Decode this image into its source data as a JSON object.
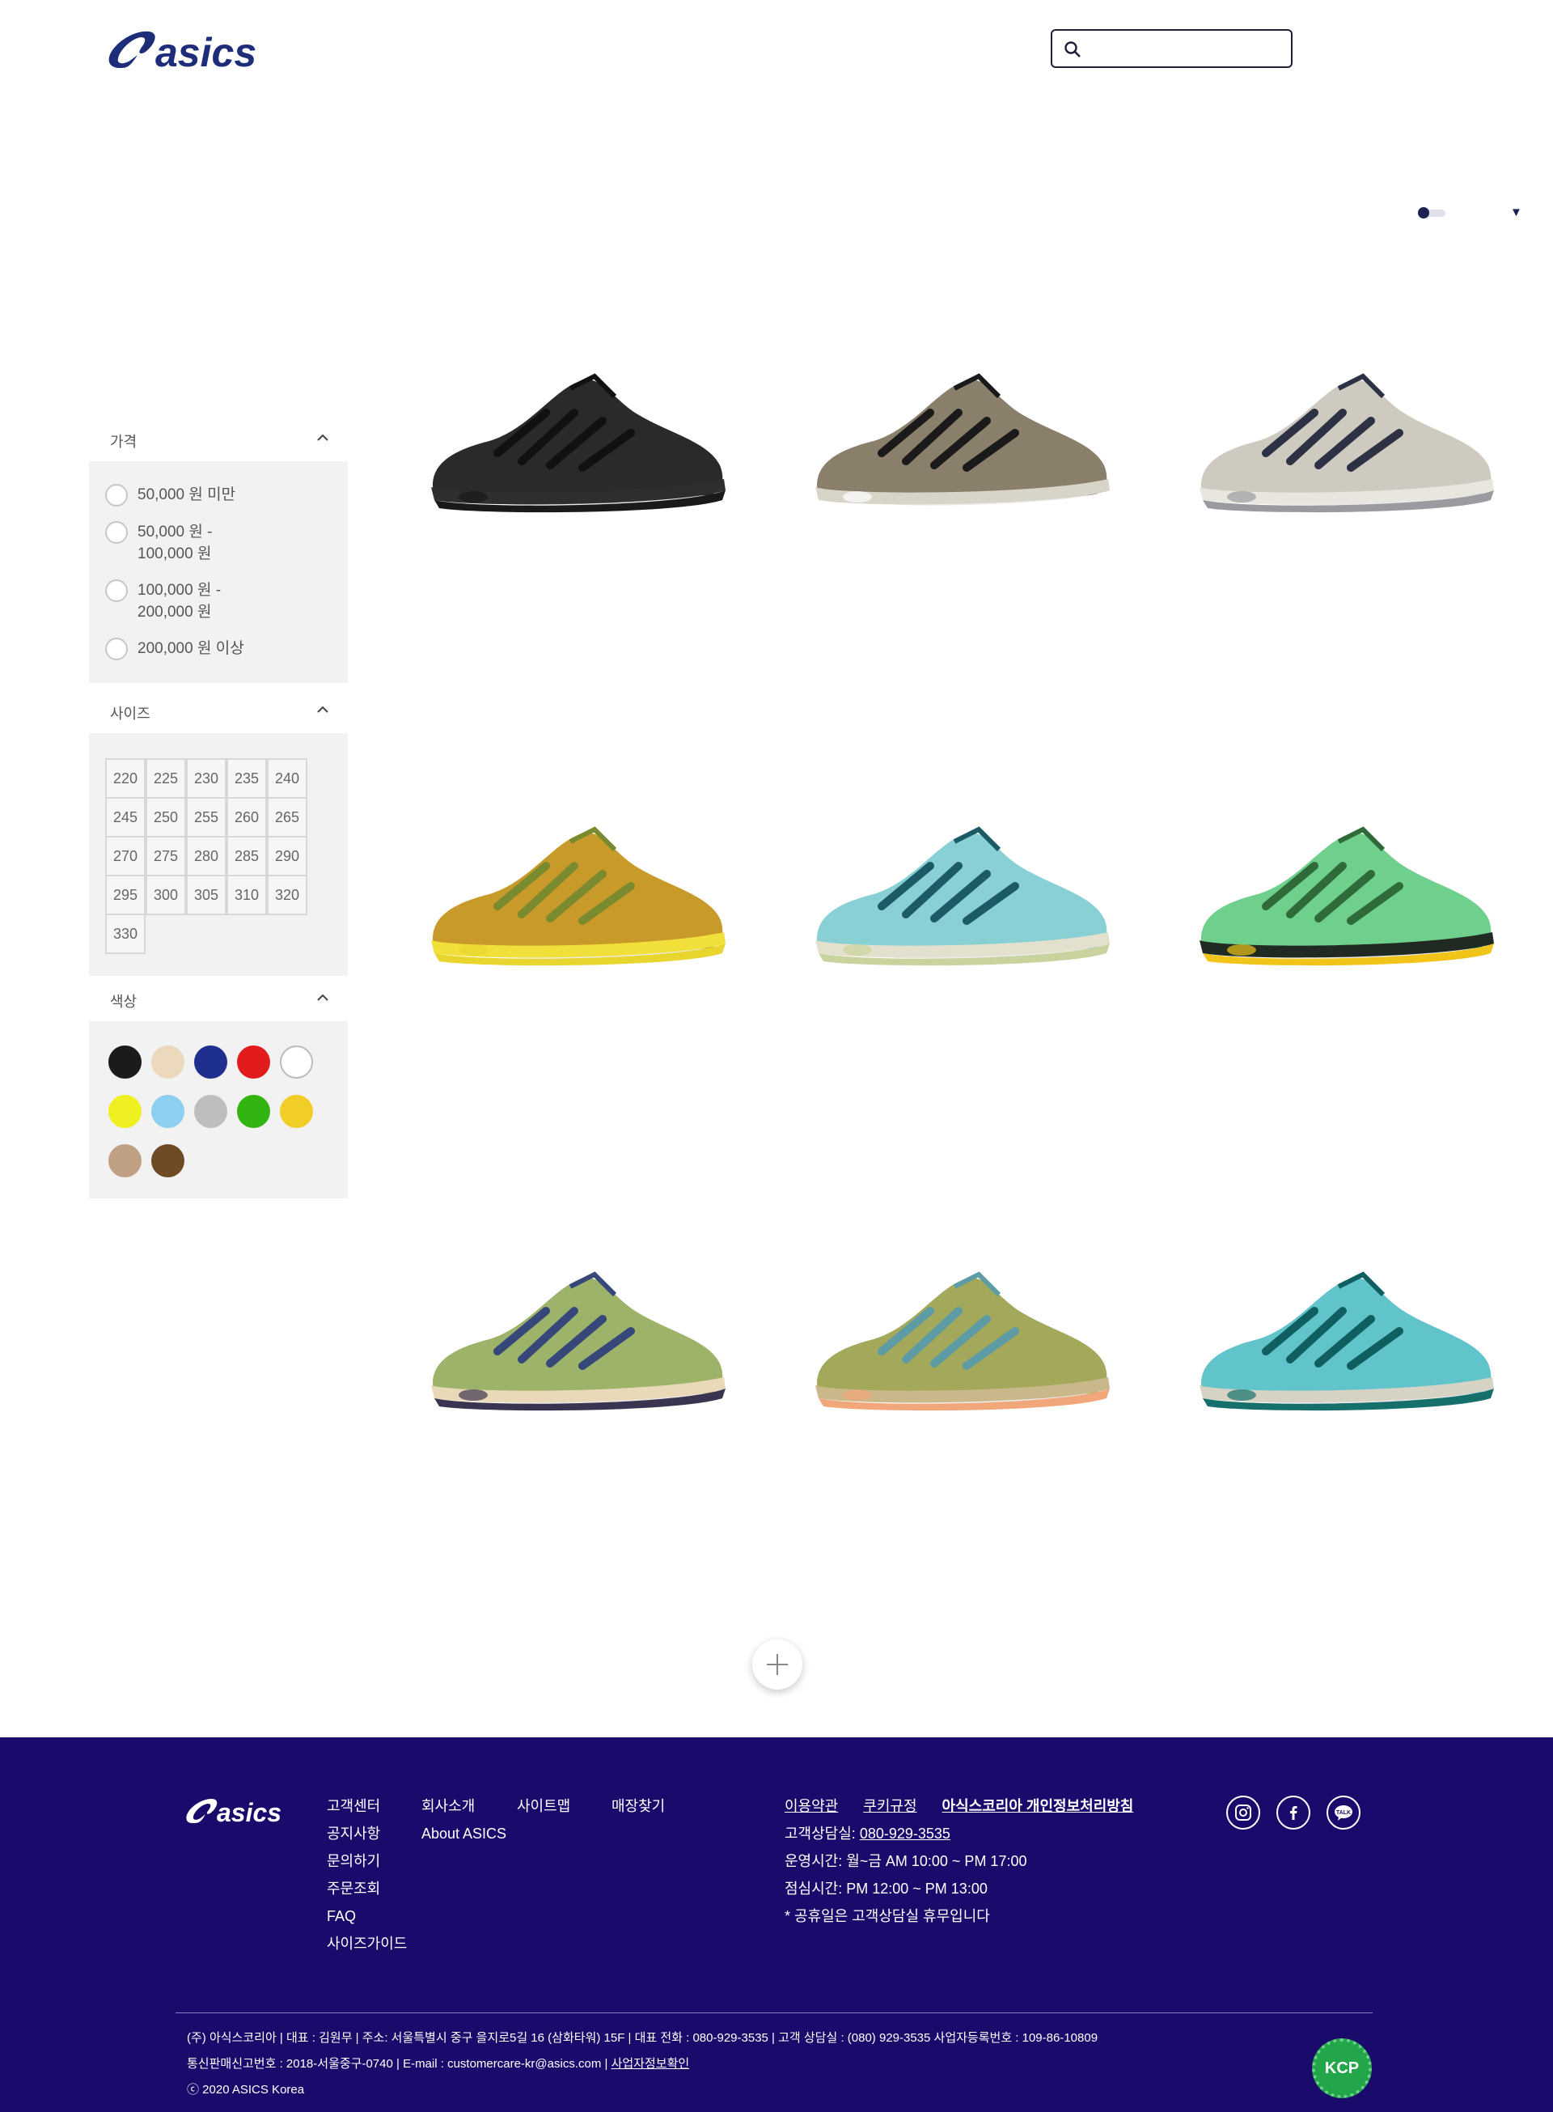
{
  "brand": {
    "name": "asics",
    "logo_text": "asics"
  },
  "search": {
    "placeholder": "",
    "value": ""
  },
  "filters": {
    "price": {
      "title": "가격",
      "options": [
        "50,000 원 미만",
        "50,000 원 - 100,000 원",
        "100,000 원 - 200,000 원",
        "200,000 원 이상"
      ]
    },
    "size": {
      "title": "사이즈",
      "options": [
        "220",
        "225",
        "230",
        "235",
        "240",
        "245",
        "250",
        "255",
        "260",
        "265",
        "270",
        "275",
        "280",
        "285",
        "290",
        "295",
        "300",
        "305",
        "310",
        "320",
        "330"
      ]
    },
    "color": {
      "title": "색상",
      "swatches": [
        "#1b1b1b",
        "#ecd9bd",
        "#1f2f8f",
        "#e21c1c",
        "#ffffff",
        "#eef022",
        "#8ccfee",
        "#bebebe",
        "#33b511",
        "#f1cd28",
        "#c0a083",
        "#6e4a25"
      ]
    }
  },
  "products": [
    {
      "name": "black-sneaker",
      "upper": "#2a2a2a",
      "accent": "#111111",
      "sole": "#1a1a1a",
      "midsole": "#2e2e2e"
    },
    {
      "name": "taupe-sneaker",
      "upper": "#8a7f6a",
      "accent": "#1a1a1a",
      "sole": "#ffffff",
      "midsole": "#d9d4c8"
    },
    {
      "name": "silver-sneaker",
      "upper": "#cfcac0",
      "accent": "#2c3143",
      "sole": "#9a9aa0",
      "midsole": "#e9e6df"
    },
    {
      "name": "yellow-brown-sneaker",
      "upper": "#c79a2a",
      "accent": "#7a8a2f",
      "sole": "#e8d52e",
      "midsole": "#f1e03a"
    },
    {
      "name": "teal-sneaker",
      "upper": "#89d0d5",
      "accent": "#1c5b66",
      "sole": "#c9d39d",
      "midsole": "#e3e0cd"
    },
    {
      "name": "green-sneaker",
      "upper": "#6fcf8c",
      "accent": "#2f6b3a",
      "sole": "#f0c419",
      "midsole": "#202a22"
    },
    {
      "name": "olive-blue-sneaker",
      "upper": "#9db36a",
      "accent": "#36477a",
      "sole": "#3b3450",
      "midsole": "#ead9b8"
    },
    {
      "name": "olive-orange-sneaker",
      "upper": "#a3a85a",
      "accent": "#5d9ca4",
      "sole": "#f2a77a",
      "midsole": "#c9b88a"
    },
    {
      "name": "teal-green-sneaker",
      "upper": "#62c4cb",
      "accent": "#0f5f61",
      "sole": "#15706c",
      "midsole": "#d6d2c4"
    }
  ],
  "footer": {
    "logo_text": "asics",
    "col1": [
      "고객센터",
      "공지사항",
      "문의하기",
      "주문조회",
      "FAQ",
      "사이즈가이드"
    ],
    "col2": [
      "회사소개",
      "About ASICS"
    ],
    "col3": [
      "사이트맵"
    ],
    "col4": [
      "매장찾기"
    ],
    "legal_links": [
      "이용약관",
      "쿠키규정",
      "아식스코리아 개인정보처리방침"
    ],
    "phone_label": "고객상담실: ",
    "phone": "080-929-3535",
    "hours": "운영시간: 월~금 AM 10:00 ~ PM 17:00",
    "lunch": "점심시간: PM 12:00 ~ PM 13:00",
    "holiday": "* 공휴일은 고객상담실 휴무입니다",
    "info_line1": "(주) 아식스코리아 |  대표 : 김원무  |  주소: 서울특별시 중구 을지로5길 16 (삼화타워) 15F  |  대표 전화 : 080-929-3535  |  고객 상담실 : (080) 929-3535 사업자등록번호 : 109-86-10809",
    "info_line2_a": "통신판매신고번호 : 2018-서울중구-0740 |  E-mail : customercare-kr@asics.com  |  ",
    "info_line2_b": "사업자정보확인",
    "copyright": "ⓒ 2020 ASICS Korea",
    "kcp": "KCP"
  }
}
